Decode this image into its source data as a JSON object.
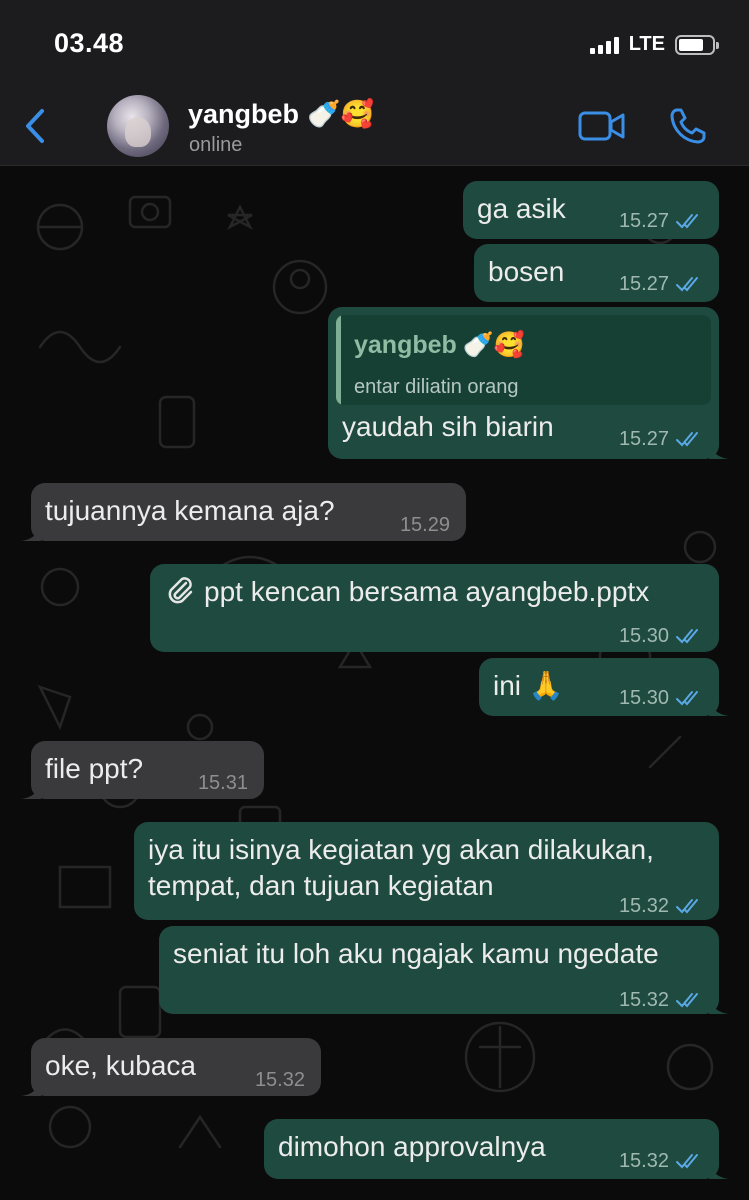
{
  "status_bar": {
    "time": "03.48",
    "network": "LTE"
  },
  "header": {
    "contact_name": "yangbeb",
    "contact_emoji": "🍼🥰",
    "contact_status": "online"
  },
  "messages": [
    {
      "direction": "outgoing",
      "text": "ga asik",
      "time": "15.27"
    },
    {
      "direction": "outgoing",
      "text": "bosen",
      "time": "15.27"
    },
    {
      "direction": "outgoing",
      "reply_to_name": "yangbeb",
      "reply_to_emoji": "🍼🥰",
      "reply_to_text": "entar diliatin orang",
      "text": "yaudah sih biarin",
      "time": "15.27"
    },
    {
      "direction": "incoming",
      "text": "tujuannya kemana aja?",
      "time": "15.29"
    },
    {
      "direction": "outgoing",
      "attachment_icon": "paperclip-icon",
      "text": "ppt kencan bersama ayangbeb.pptx",
      "time": "15.30"
    },
    {
      "direction": "outgoing",
      "text": "ini",
      "emoji": "🙏",
      "time": "15.30"
    },
    {
      "direction": "incoming",
      "text": "file ppt?",
      "time": "15.31"
    },
    {
      "direction": "outgoing",
      "text_line1": "iya itu isinya kegiatan yg akan dilakukan,",
      "text_line2": "tempat, dan tujuan kegiatan",
      "time": "15.32"
    },
    {
      "direction": "outgoing",
      "text": "seniat itu loh aku ngajak kamu ngedate",
      "time": "15.32"
    },
    {
      "direction": "incoming",
      "text": "oke, kubaca",
      "time": "15.32"
    },
    {
      "direction": "outgoing",
      "text": "dimohon approvalnya",
      "time": "15.32"
    }
  ],
  "colors": {
    "accent": "#3a8ee6",
    "outgoing_bubble": "#1f4a3f",
    "incoming_bubble": "#3a3a3c",
    "read_ticks": "#5aa9e6"
  }
}
